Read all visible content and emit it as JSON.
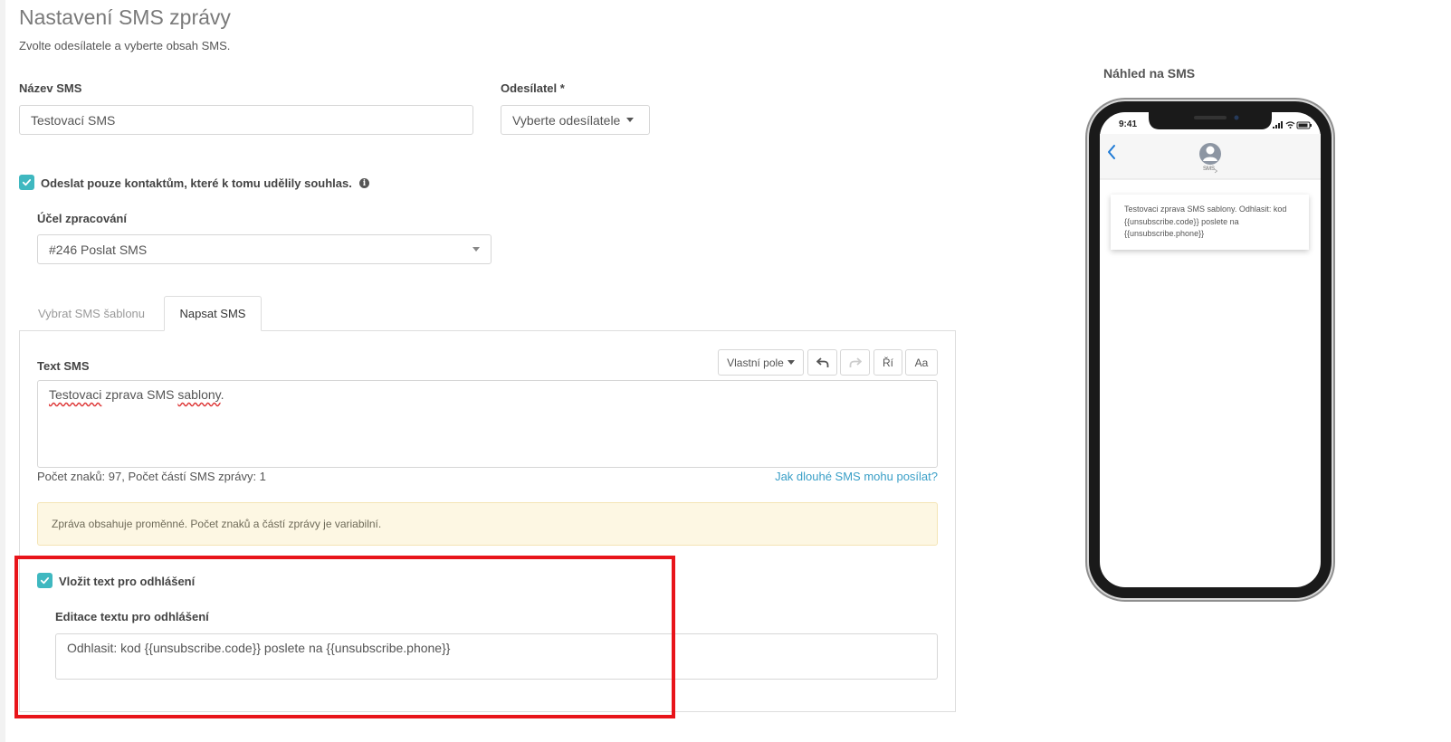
{
  "header": {
    "title": "Nastavení SMS zprávy",
    "subtitle": "Zvolte odesílatele a vyberte obsah SMS."
  },
  "form": {
    "name_label": "Název SMS",
    "name_value": "Testovací SMS",
    "sender_label": "Odesílatel *",
    "sender_value": "Vyberte odesílatele",
    "consent_label": "Odeslat pouze kontaktům, které k tomu udělily souhlas.",
    "consent_checked": true,
    "purpose_label": "Účel zpracování",
    "purpose_value": "#246 Poslat SMS"
  },
  "tabs": [
    {
      "label": "Vybrat SMS šablonu",
      "active": false
    },
    {
      "label": "Napsat SMS",
      "active": true
    }
  ],
  "editor": {
    "label": "Text SMS",
    "toolbar": {
      "custom_fields": "Vlastní pole",
      "special_chars": "Ří",
      "case": "Aa"
    },
    "text_word1": "Testovaci",
    "text_word2": " zprava SMS ",
    "text_word3": "sablony",
    "text_word4": ".",
    "counter": "Počet znaků: 97, Počet částí SMS zprávy: 1",
    "help_link": "Jak dlouhé SMS mohu posílat?",
    "warning": "Zpráva obsahuje proměnné. Počet znaků a částí zprávy je variabilní."
  },
  "unsubscribe": {
    "checkbox_label": "Vložit text pro odhlášení",
    "checked": true,
    "edit_label": "Editace textu pro odhlášení",
    "text": "Odhlasit: kod {{unsubscribe.code}} poslete na {{unsubscribe.phone}}"
  },
  "preview": {
    "title": "Náhled na SMS",
    "time": "9:41",
    "contact": "SMS",
    "message": "Testovaci zprava SMS sablony. Odhlasit: kod {{unsubscribe.code}} poslete na {{unsubscribe.phone}}"
  },
  "colors": {
    "accent": "#3fb8c0",
    "link": "#3a9fc7",
    "highlight": "#e8141a",
    "warning_bg": "#fdf7e3"
  }
}
